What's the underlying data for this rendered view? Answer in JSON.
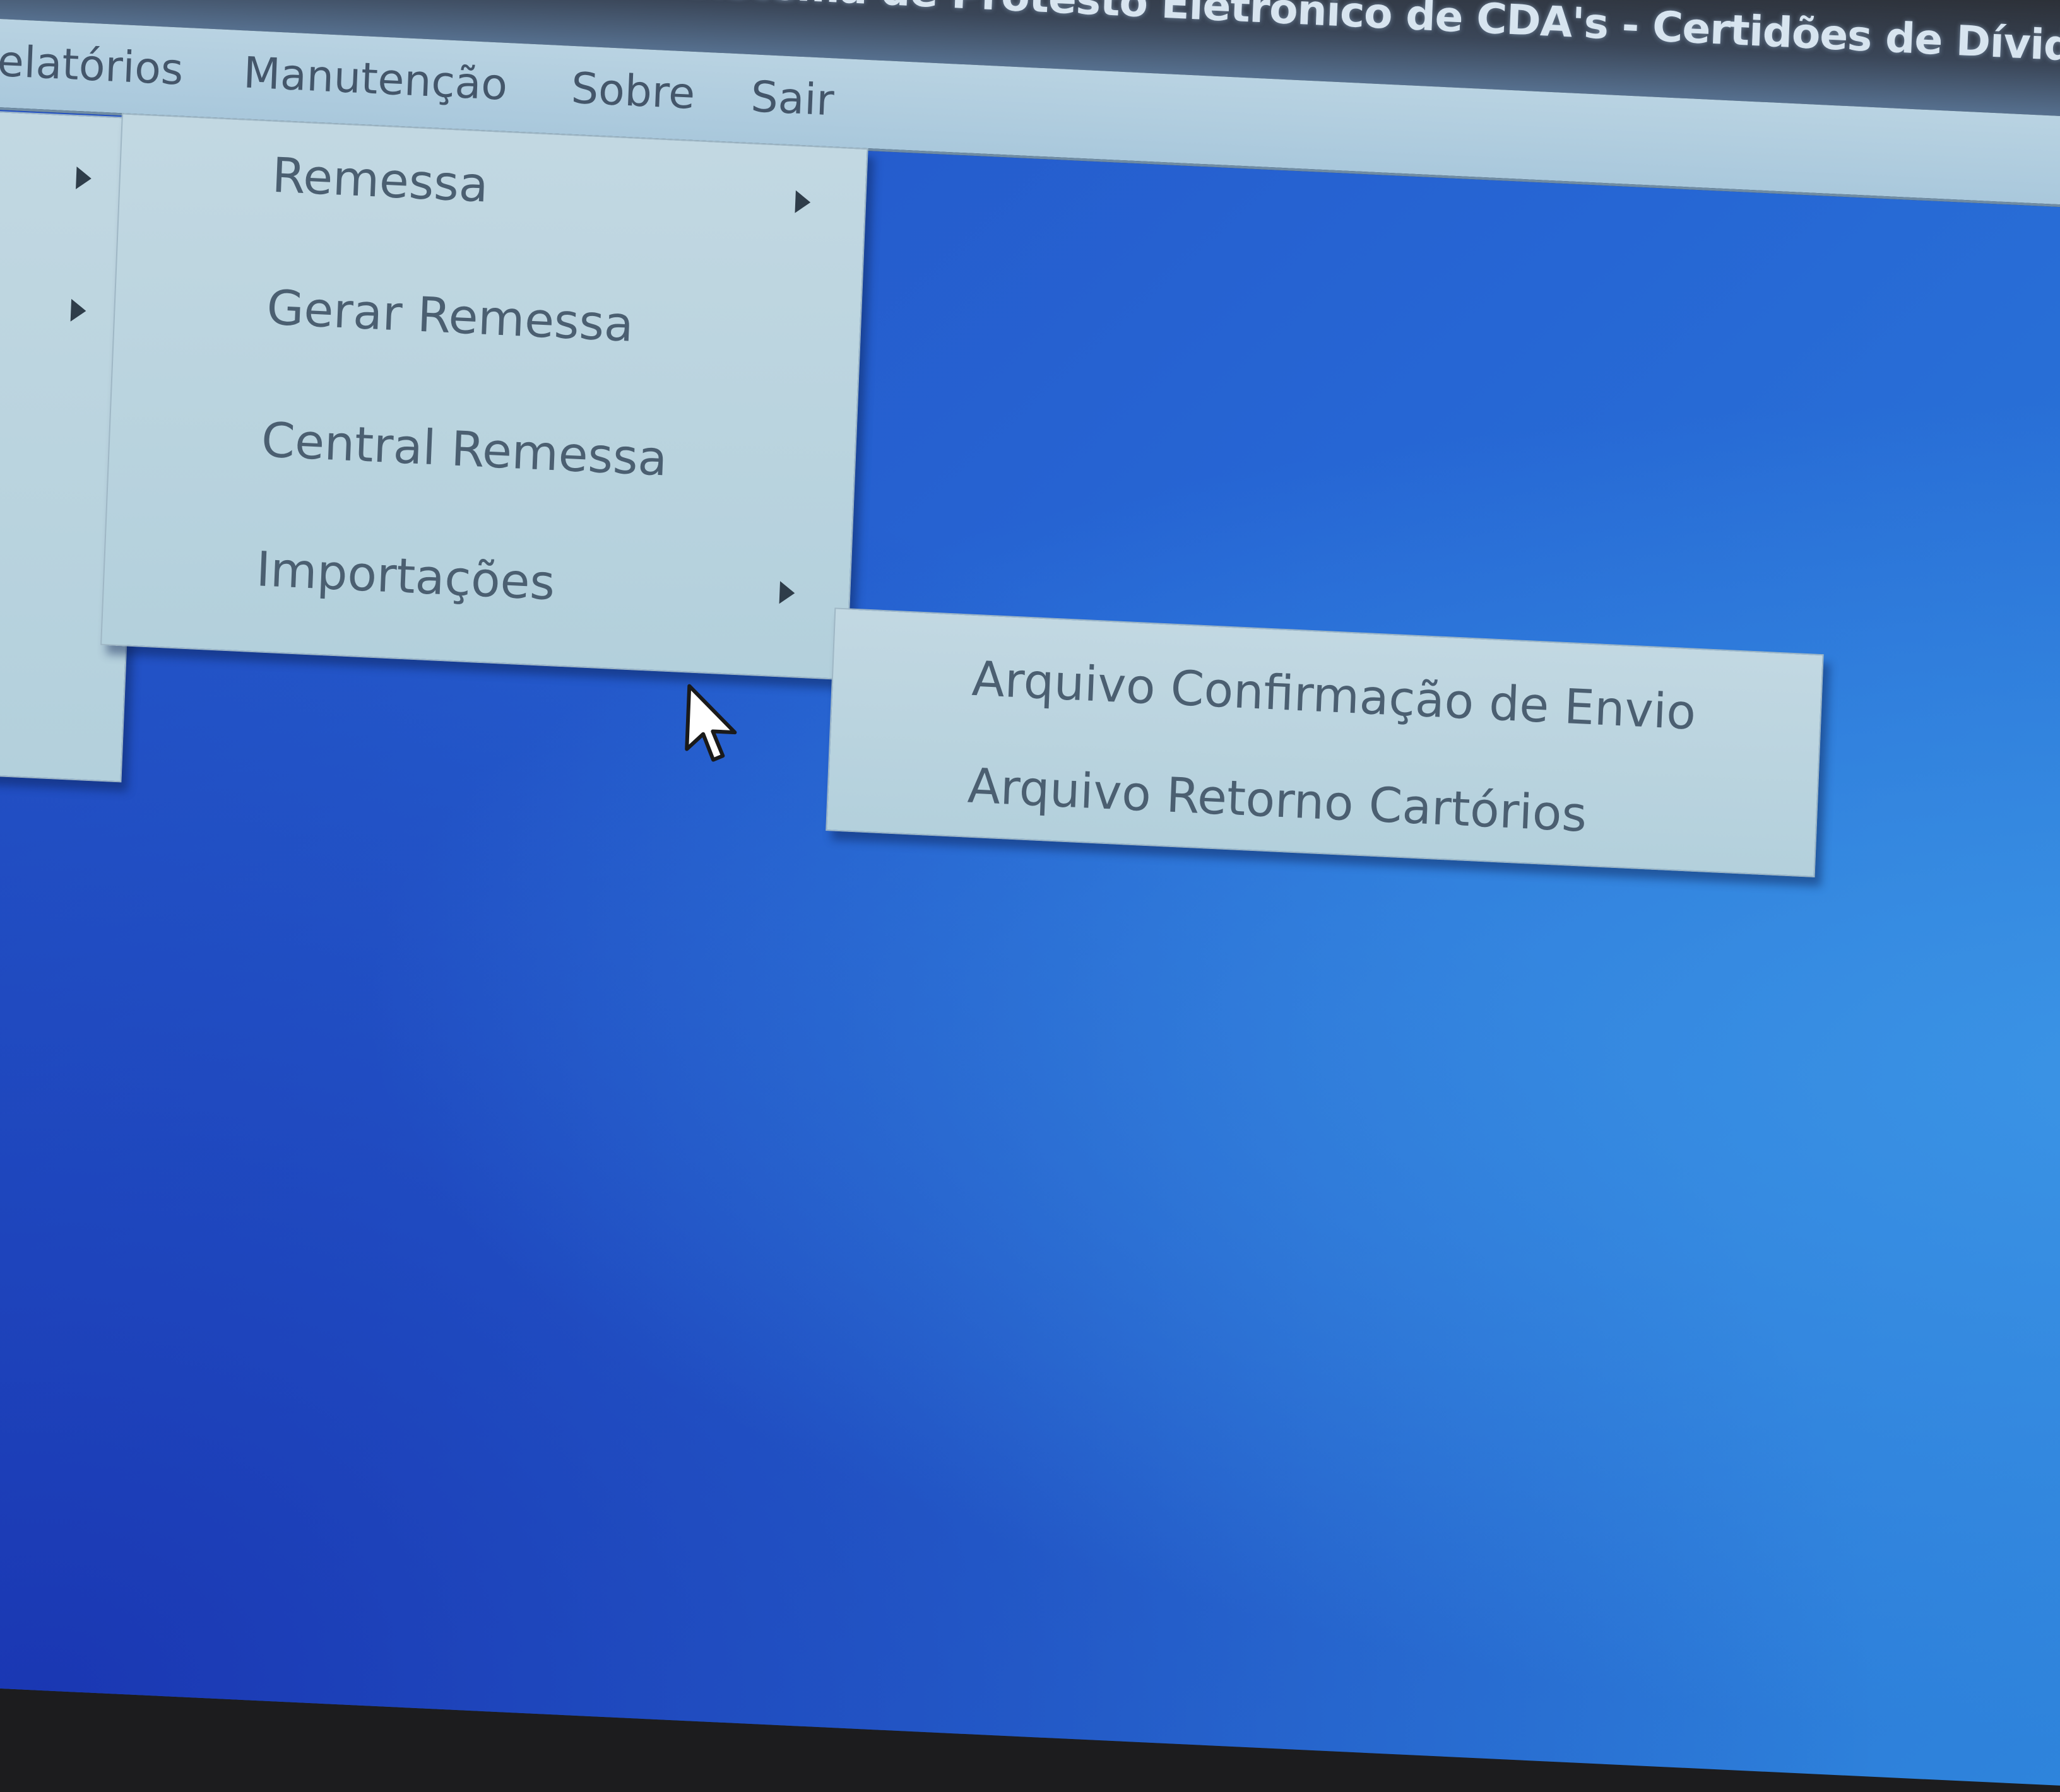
{
  "window": {
    "title": "Sistema de Protesto Eletrônico de CDA's  -  Certidões de Dívida A"
  },
  "menubar": {
    "items": [
      {
        "label": "elatórios"
      },
      {
        "label": "Manutenção"
      },
      {
        "label": "Sobre"
      },
      {
        "label": "Sair"
      }
    ]
  },
  "main_menu": {
    "items": [
      {
        "label": "Remessa",
        "has_submenu": true
      },
      {
        "label": "Gerar Remessa",
        "has_submenu": false
      },
      {
        "label": "Central Remessa",
        "has_submenu": false
      },
      {
        "label": "Importações",
        "has_submenu": true
      }
    ]
  },
  "submenu_importacoes": {
    "items": [
      {
        "label": "Arquivo Confirmação de Envio"
      },
      {
        "label": "Arquivo Retorno Cartórios"
      }
    ]
  },
  "colors": {
    "menu_bg": "#b9d3df",
    "menu_text": "#4b5f71",
    "desktop": "#2660d0",
    "titlebar": "#2a2d33"
  }
}
